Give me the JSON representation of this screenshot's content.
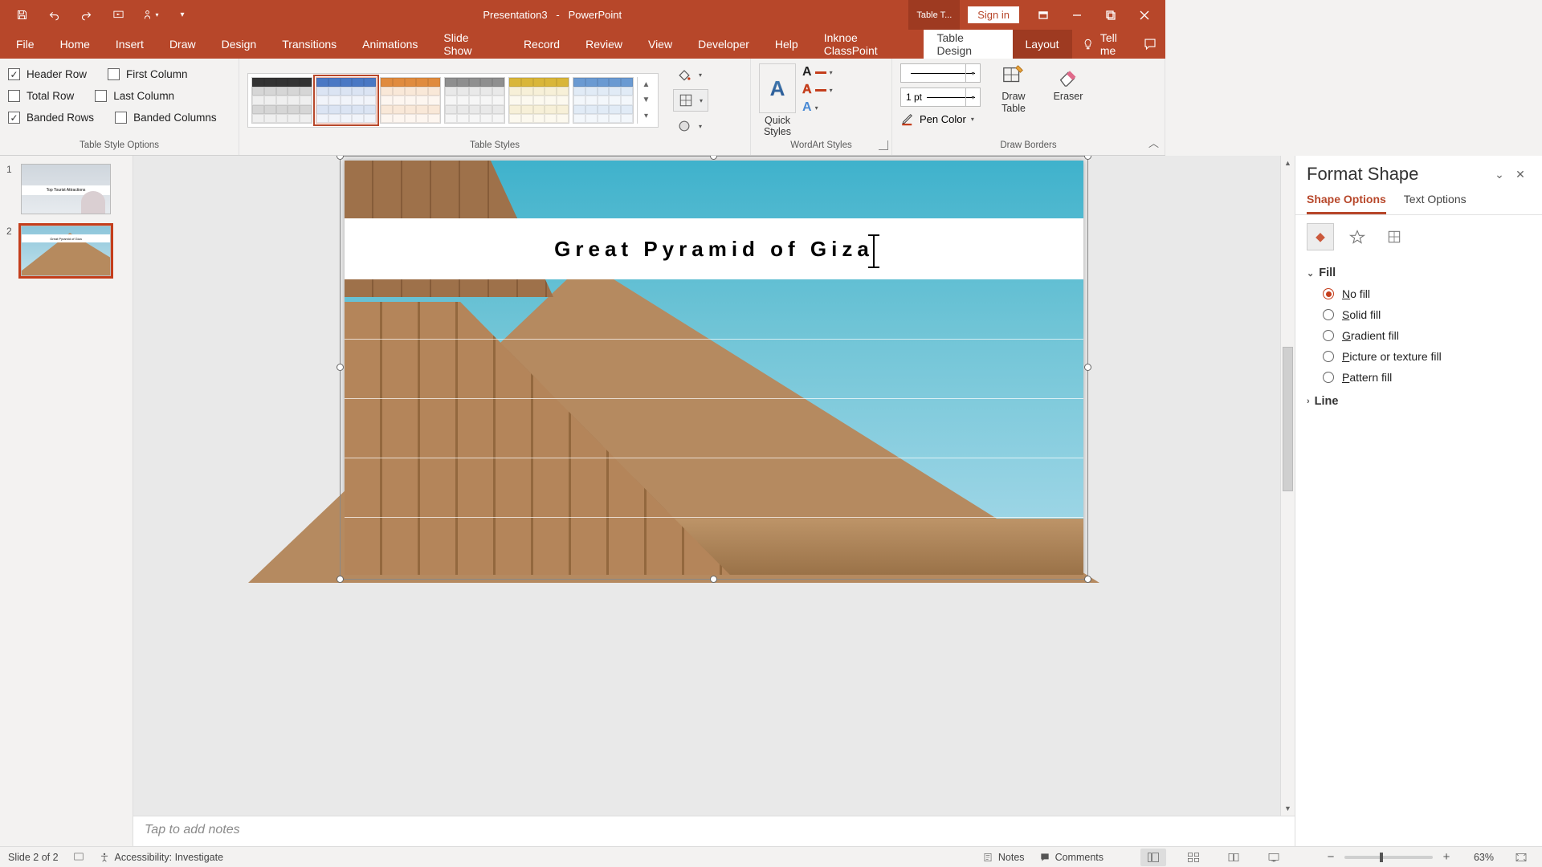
{
  "title": {
    "doc": "Presentation3",
    "app": "PowerPoint",
    "context_tab": "Table T...",
    "signin": "Sign in"
  },
  "ribbon_tabs": [
    "File",
    "Home",
    "Insert",
    "Draw",
    "Design",
    "Transitions",
    "Animations",
    "Slide Show",
    "Record",
    "Review",
    "View",
    "Developer",
    "Help",
    "Inknoe ClassPoint"
  ],
  "context_tabs": [
    "Table Design",
    "Layout"
  ],
  "active_tab": "Table Design",
  "tellme": "Tell me",
  "groups": {
    "tso": {
      "label": "Table Style Options",
      "opts": {
        "header_row": {
          "label": "Header Row",
          "checked": true
        },
        "total_row": {
          "label": "Total Row",
          "checked": false
        },
        "banded_rows": {
          "label": "Banded Rows",
          "checked": true
        },
        "first_column": {
          "label": "First Column",
          "checked": false
        },
        "last_column": {
          "label": "Last Column",
          "checked": false
        },
        "banded_columns": {
          "label": "Banded Columns",
          "checked": false
        }
      }
    },
    "styles": {
      "label": "Table Styles"
    },
    "wordart": {
      "label": "WordArt Styles",
      "quick_styles": "Quick\nStyles"
    },
    "borders": {
      "label": "Draw Borders",
      "pen_weight": "1 pt",
      "pen_color": "Pen Color",
      "draw_table": "Draw\nTable",
      "eraser": "Eraser"
    }
  },
  "slide": {
    "title": "Great Pyramid of Giza",
    "notes_placeholder": "Tap to add notes"
  },
  "thumbs": [
    {
      "num": "1",
      "caption": "Top Tourist Attractions"
    },
    {
      "num": "2",
      "caption": "Great Pyramid of Giza"
    }
  ],
  "pane": {
    "title": "Format Shape",
    "tabs": [
      "Shape Options",
      "Text Options"
    ],
    "active_tab": "Shape Options",
    "sections": {
      "fill": {
        "label": "Fill",
        "options": [
          "No fill",
          "Solid fill",
          "Gradient fill",
          "Picture or texture fill",
          "Pattern fill"
        ],
        "selected": "No fill"
      },
      "line": {
        "label": "Line"
      }
    }
  },
  "status": {
    "slide": "Slide 2 of 2",
    "accessibility": "Accessibility: Investigate",
    "notes": "Notes",
    "comments": "Comments",
    "zoom": "63%"
  },
  "gallery_colors": [
    "#333333",
    "#4a78c4",
    "#e08b3e",
    "#8f8f8f",
    "#d9b63a",
    "#6a9ad2"
  ]
}
